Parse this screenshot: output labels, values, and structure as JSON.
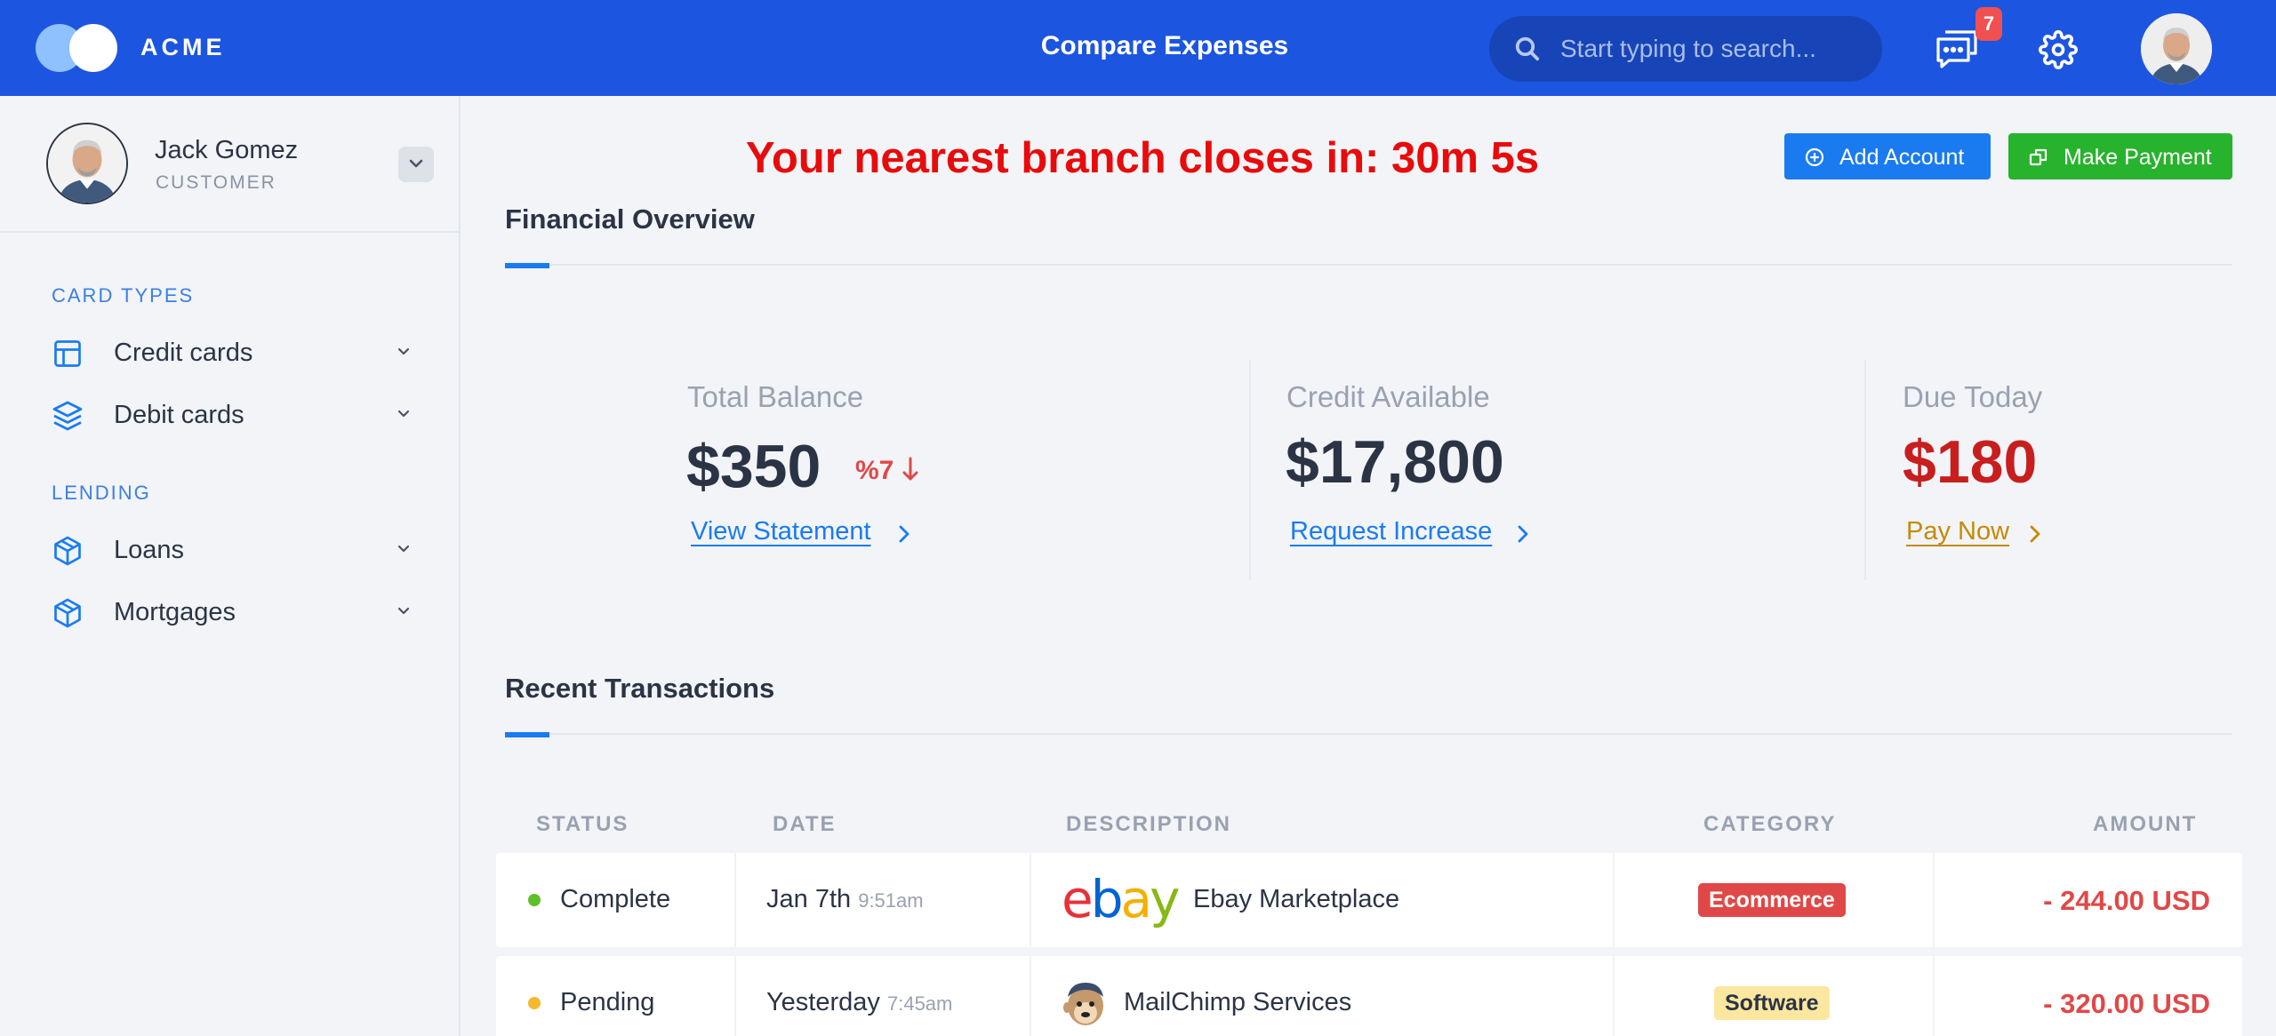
{
  "header": {
    "brand": "ACME",
    "title": "Compare Expenses",
    "search_placeholder": "Start typing to search...",
    "notification_count": "7"
  },
  "sidebar": {
    "user": {
      "name": "Jack Gomez",
      "role": "CUSTOMER"
    },
    "sections": [
      {
        "label": "CARD TYPES",
        "items": [
          {
            "label": "Credit cards",
            "icon": "layout-icon"
          },
          {
            "label": "Debit cards",
            "icon": "layers-icon"
          }
        ]
      },
      {
        "label": "LENDING",
        "items": [
          {
            "label": "Loans",
            "icon": "package-icon"
          },
          {
            "label": "Mortgages",
            "icon": "package-icon"
          }
        ]
      }
    ]
  },
  "main": {
    "alert": "Your nearest branch closes in: 30m 5s",
    "buttons": {
      "add_account": "Add Account",
      "make_payment": "Make Payment"
    },
    "overview": {
      "title": "Financial Overview",
      "stats": [
        {
          "label": "Total Balance",
          "value": "$350",
          "delta": "%7",
          "link": "View Statement"
        },
        {
          "label": "Credit Available",
          "value": "$17,800",
          "link": "Request Increase"
        },
        {
          "label": "Due Today",
          "value": "$180",
          "link": "Pay Now"
        }
      ]
    },
    "transactions": {
      "title": "Recent Transactions",
      "columns": [
        "STATUS",
        "DATE",
        "DESCRIPTION",
        "CATEGORY",
        "AMOUNT"
      ],
      "rows": [
        {
          "status": "Complete",
          "status_color": "#5fbf2a",
          "date": "Jan 7th",
          "time": "9:51am",
          "logo": "ebay-logo",
          "logo_text": "ebay",
          "description": "Ebay Marketplace",
          "category": "Ecommerce",
          "category_style": "red",
          "amount": "- 244.00 USD"
        },
        {
          "status": "Pending",
          "status_color": "#f5b82e",
          "date": "Yesterday",
          "time": "7:45am",
          "logo": "mailchimp-logo",
          "description": "MailChimp Services",
          "category": "Software",
          "category_style": "yellow",
          "amount": "- 320.00 USD"
        }
      ]
    }
  },
  "colors": {
    "header_bg": "#1c55e0",
    "accent": "#1a7bf0",
    "success": "#27b32d",
    "danger": "#e80b0b",
    "due": "#c81e1e",
    "pay_link": "#c58a00"
  }
}
